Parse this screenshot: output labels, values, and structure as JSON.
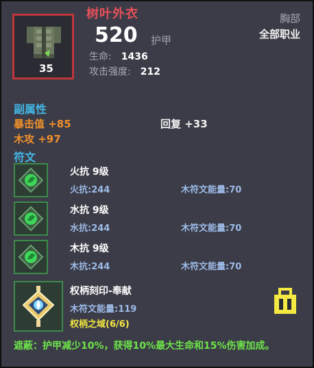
{
  "item": {
    "name": "树叶外衣",
    "level": "35",
    "slot": "胸部",
    "class_restriction": "全部职业",
    "armor_value": "520",
    "armor_label": "护甲",
    "stats": [
      {
        "label": "生命:",
        "value": "1436"
      },
      {
        "label": "攻击强度:",
        "value": "212"
      }
    ]
  },
  "secondary": {
    "title": "副属性",
    "crit": "暴击值 +85",
    "regen": "回复 +33",
    "wood_atk": "木攻 +97"
  },
  "runes": {
    "title": "符文",
    "items": [
      {
        "name": "火抗 9级",
        "effect": "火抗:244",
        "energy": "木符文能量:70",
        "icon": "green-leaf-rune-icon"
      },
      {
        "name": "水抗 9级",
        "effect": "水抗:244",
        "energy": "木符文能量:70",
        "icon": "green-leaf-rune-icon"
      },
      {
        "name": "木抗 9级",
        "effect": "木抗:244",
        "energy": "木符文能量:70",
        "icon": "green-leaf-rune-icon"
      }
    ],
    "scepter": {
      "name": "权柄刻印-奉献",
      "energy": "木符文能量:119",
      "domain": "权柄之域(6/6)",
      "icon": "scepter-seal-icon"
    }
  },
  "set_bonus": "遮蔽：护甲减少10%，获得10%最大生命和15%伤害加成。",
  "colors": {
    "title": "#e8505a",
    "section": "#45b7e6",
    "orange": "#f0902c",
    "rune_text": "#9ebbe8",
    "yellow": "#f4e842",
    "green": "#6ee44a",
    "legendary_border": "#c0363b"
  }
}
